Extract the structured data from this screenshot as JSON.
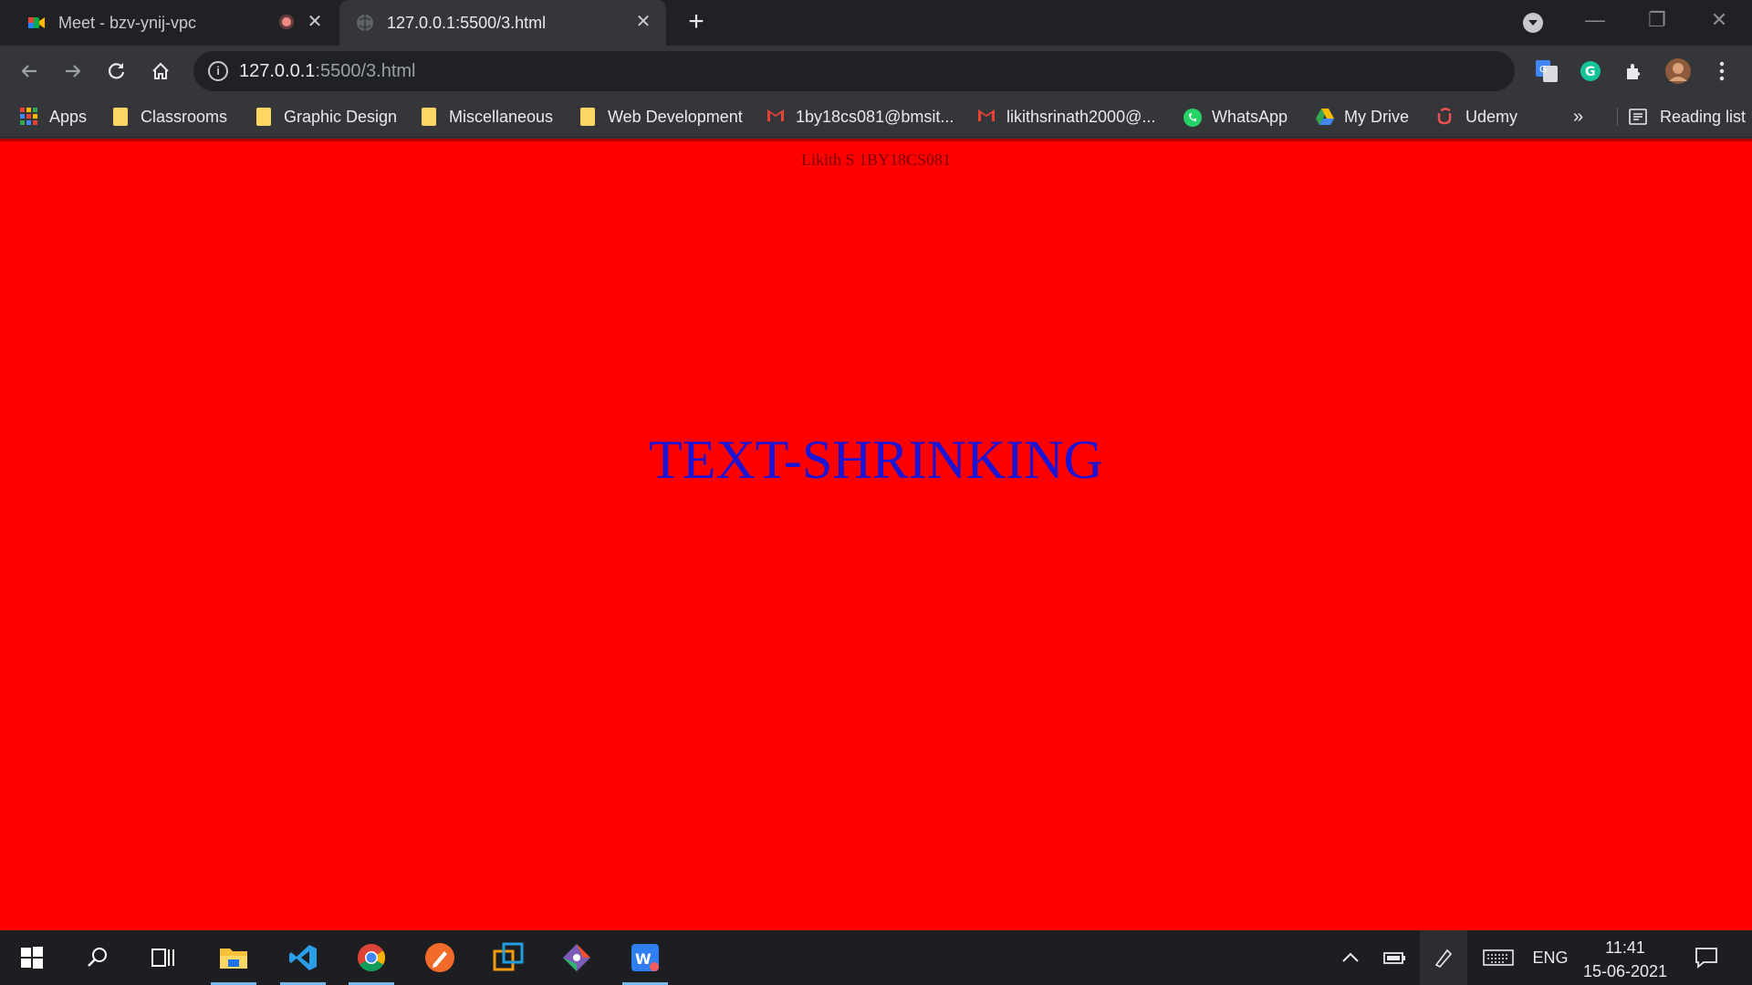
{
  "tabs": [
    {
      "title": "Meet - bzv-ynij-vpc",
      "close": "✕",
      "active": false
    },
    {
      "title": "127.0.0.1:5500/3.html",
      "close": "✕",
      "active": true
    }
  ],
  "new_tab": "+",
  "window_controls": {
    "minimize": "—",
    "restore": "❐",
    "close": "✕"
  },
  "omnibox": {
    "host": "127.0.0.1",
    "path": ":5500/3.html",
    "info": "i"
  },
  "bookmarks": [
    {
      "label": "Apps",
      "icon": "apps-grid-icon"
    },
    {
      "label": "Classrooms",
      "icon": "folder-icon"
    },
    {
      "label": "Graphic Design",
      "icon": "folder-icon"
    },
    {
      "label": "Miscellaneous",
      "icon": "folder-icon"
    },
    {
      "label": "Web Development",
      "icon": "folder-icon"
    },
    {
      "label": "1by18cs081@bmsit...",
      "icon": "gmail-icon"
    },
    {
      "label": "likithsrinath2000@...",
      "icon": "gmail-icon"
    },
    {
      "label": "WhatsApp",
      "icon": "whatsapp-icon"
    },
    {
      "label": "My Drive",
      "icon": "drive-icon"
    },
    {
      "label": "Udemy",
      "icon": "udemy-icon"
    }
  ],
  "bookmarks_overflow": "»",
  "reading_list": "Reading list",
  "page": {
    "author": "Likith S 1BY18CS081",
    "heading": "TEXT-SHRINKING",
    "background": "#ff0000",
    "heading_color": "#1a14d6"
  },
  "taskbar": {
    "language": "ENG",
    "time": "11:41",
    "date": "15-06-2021"
  }
}
